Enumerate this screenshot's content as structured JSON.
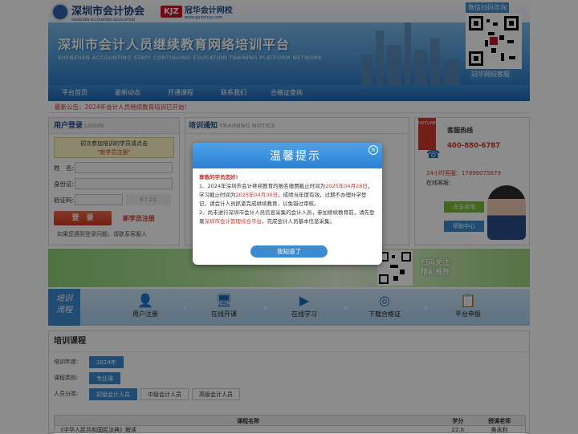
{
  "header": {
    "logo1_name": "深圳市会计协会",
    "logo1_en": "SHENZHEN ACCOUNTING ASSOCIATION",
    "logo2_badge": "KJZ",
    "logo2_name": "冠华会计网校",
    "logo2_url": "www.guanhua.com",
    "title": "深圳市会计人员继续教育网络培训平台",
    "subtitle": "SHENZHEN ACCOUNTING STAFF CONTINUING EDUCATION TRAINING PLATFORM NETWORK",
    "qr_top": "微信扫码咨询",
    "qr_bottom": "冠华网校客服"
  },
  "nav": [
    "平台首页",
    "最新动态",
    "开通课程",
    "联系我们",
    "合格证查询"
  ],
  "notice": "最新公告：2024年会计人员继续教育培训已开始!",
  "login": {
    "title": "用户登录",
    "title_en": "LOGIN",
    "tip_line1": "初次参加培训的学员请点击",
    "tip_line2": "\"新学员注册\"",
    "name_label": "姓　名:",
    "id_label": "身份证:",
    "code_label": "验证码:",
    "captcha": "8720",
    "login_btn": "登　录",
    "register": "新学员注册",
    "help": "如果您遇到登录问题，请联系客服人"
  },
  "training_notice": {
    "title": "培训通知",
    "title_en": "TRAINING NOTICE"
  },
  "hotline": {
    "tag": "HOTLINE",
    "title": "客服热线",
    "phone": "400-880-6787",
    "service": "24小时客服：17896075879",
    "online": "在线客服：",
    "btn1": "点击咨询",
    "btn2": "帮助中心"
  },
  "banner": {
    "line1": "扫码关注",
    "line2": "精彩推荐"
  },
  "flow": {
    "lead1": "培训",
    "lead2": "流程",
    "steps": [
      "用户注册",
      "在线开课",
      "在线学习",
      "下载合格证",
      "平台申报"
    ],
    "icons": [
      "user-icon",
      "monitor-icon",
      "play-icon",
      "certificate-icon",
      "report-icon"
    ]
  },
  "course": {
    "title": "培训课程",
    "year_label": "培训年度:",
    "year": "2024年",
    "type_label": "课程类别:",
    "type": "专业课",
    "class_label": "人员分类:",
    "classes": [
      "初级会计人员",
      "中级会计人员",
      "高级会计人员"
    ],
    "headers": [
      "课程名称",
      "学分",
      "授课老师"
    ],
    "row1": [
      "《中华人民共和国民法典》解读",
      "22.0",
      "桑永利"
    ]
  },
  "modal": {
    "title": "温馨提示",
    "greeting": "尊敬的学员您好!",
    "p1_a": "1、2024年深圳市会计继续教育的报名缴费截止时间为",
    "p1_date1": "2025年04月28日",
    "p1_b": "，学习截止时间为",
    "p1_date2": "2025年04月30日",
    "p1_c": "。成绩当年度有效，过期不办理补学登记，请会计人员抓紧完成继续教育，以免错过审核。",
    "p2_a": "2、尚未进行深圳市会计人员信息采集的会计人员，参加继续教育前，请先登录",
    "p2_link": "深圳市会计管理综合平台",
    "p2_b": "，完成会计人员基本信息采集。",
    "ok": "我知道了"
  }
}
